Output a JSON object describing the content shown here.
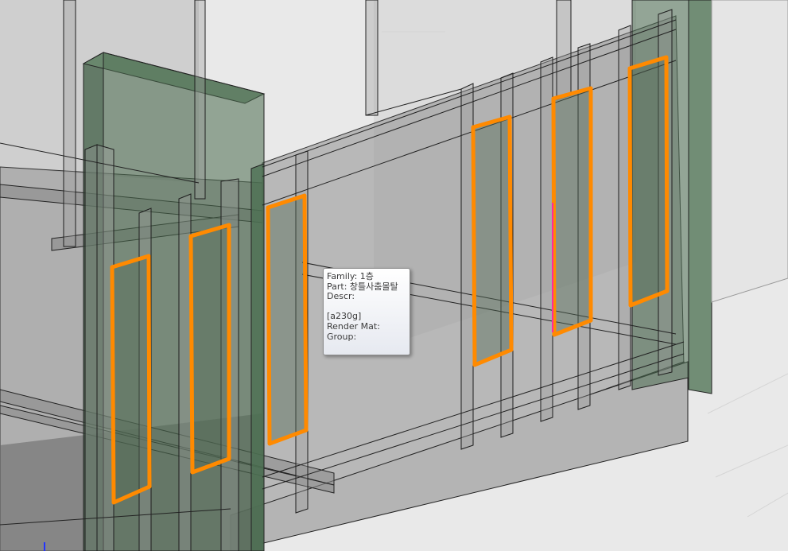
{
  "tooltip": {
    "family": "Family: 1층",
    "part": "Part: 창틀사춤몰탈",
    "descr": "Descr:",
    "blank": "",
    "code": "[a230g]",
    "render_mat": "Render Mat:",
    "group": "Group:"
  },
  "colors": {
    "background": "#e9e9e9",
    "wall_glass": "#8a8a8a",
    "green_panel": "#4f6e52",
    "highlight": "#ff8a00",
    "edge": "#222222",
    "accent_pink": "#ff2aa0"
  },
  "icons": {
    "axis": "z-axis-indicator"
  }
}
